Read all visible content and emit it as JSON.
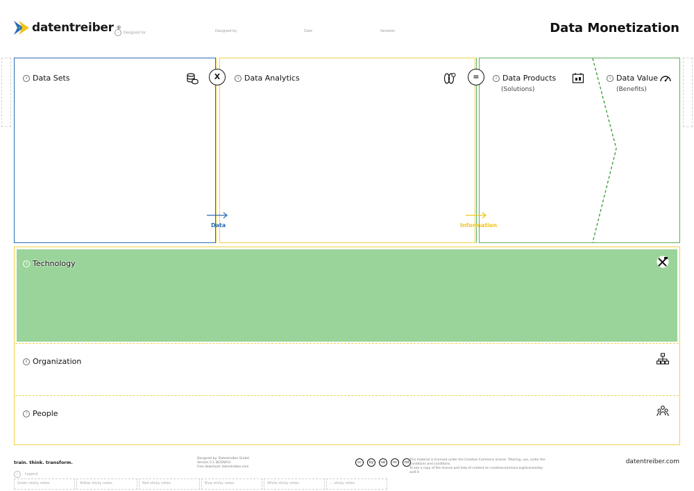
{
  "header": {
    "logo_text": "datentreiber",
    "logo_mark": "®",
    "meta": {
      "designed_for": "Designed for",
      "designed_by": "Designed by",
      "date": "Date",
      "iteration": "Iteration"
    },
    "title": "Data Monetization"
  },
  "canvas": {
    "data_sets": {
      "num": "4",
      "label": "Data Sets",
      "icon": "database-coins-icon"
    },
    "data_analytics": {
      "num": "3",
      "label": "Data Analytics",
      "icon": "analytics-brain-icon"
    },
    "data_products": {
      "num": "2",
      "label": "Data Products",
      "sub": "(Solutions)",
      "icon": "dashboard-product-icon"
    },
    "data_value": {
      "num": "1",
      "label": "Data Value",
      "sub": "(Benefits)",
      "icon": "speedometer-icon"
    },
    "operator_multiply": "X",
    "operator_equals": "=",
    "flow_data": "Data",
    "flow_information": "Information",
    "colors": {
      "blue": "#2a6db4",
      "yellow": "#f0d046",
      "green": "#5fae5f",
      "tech_fill": "#9ad49a"
    }
  },
  "layers": {
    "technology": {
      "num": "5",
      "label": "Technology",
      "icon": "tools-icon"
    },
    "organization": {
      "num": "6",
      "label": "Organization",
      "icon": "org-chart-icon"
    },
    "people": {
      "num": "7",
      "label": "People",
      "icon": "people-group-icon"
    }
  },
  "footer": {
    "tagline": "train. think. transform.",
    "credits": [
      "Designed by: Datentreiber GmbH",
      "Version 5.1 DE/EN/CH",
      "Free download: datentreiber.com"
    ],
    "license": [
      "This material is licensed under the Creative Commons license \"Sharing, use, under the Conditions and conditions.",
      "To see a copy of the license and help of content on creativecommons.org/licenses/by-sa/4.0"
    ],
    "cc_icons": [
      "cc",
      "by",
      "sa",
      "nc",
      "nd"
    ],
    "site": "datentreiber.com",
    "legend_label": "Legend",
    "legend_items": [
      "Green sticky notes",
      "Yellow sticky notes",
      "Red sticky notes",
      "Blue sticky notes",
      "White sticky notes",
      "... sticky notes"
    ]
  }
}
